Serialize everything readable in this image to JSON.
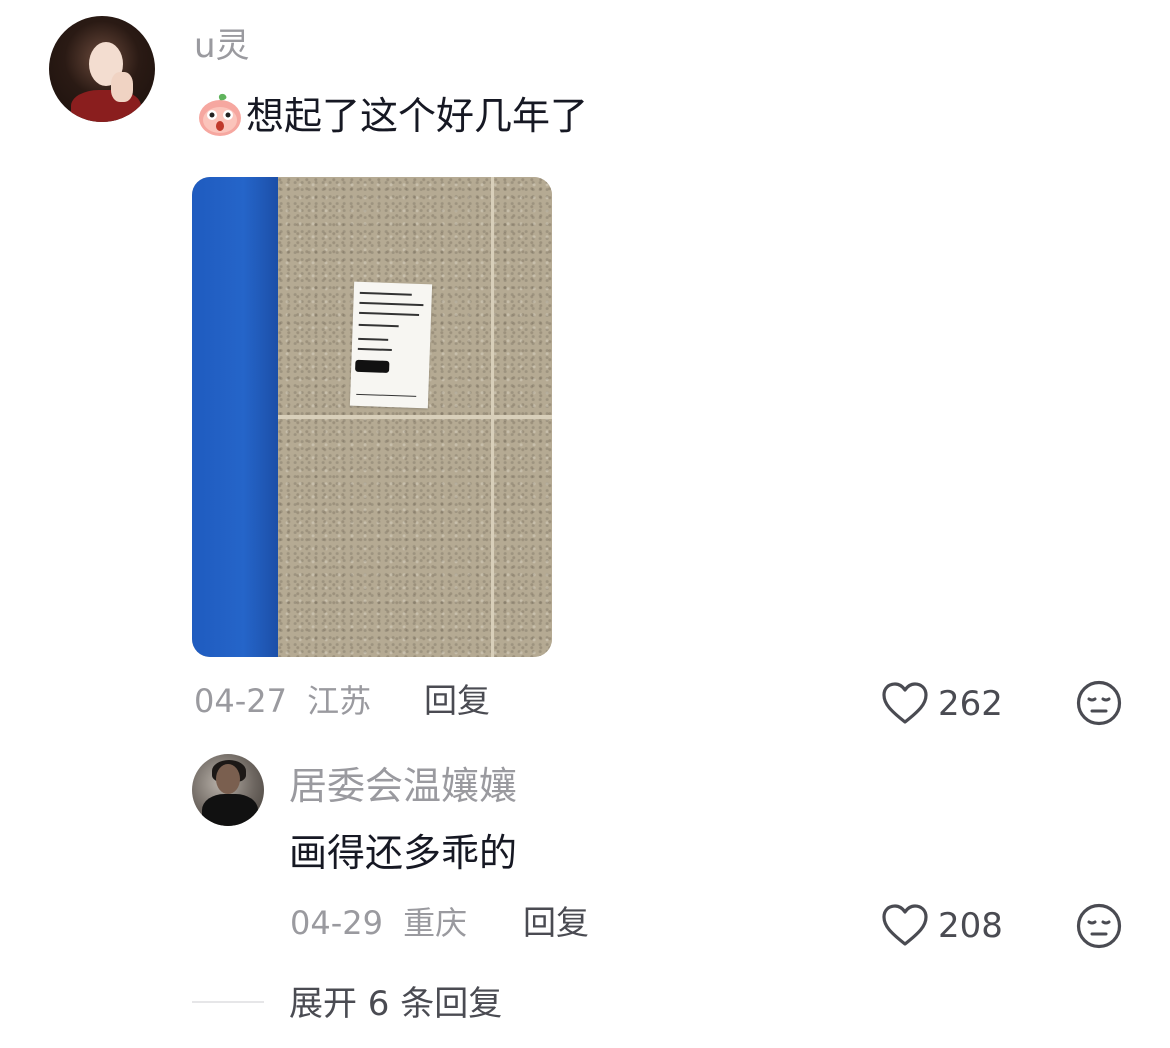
{
  "comment": {
    "username": "u灵",
    "emoji_icon": "surprised-peach-emoji",
    "text": "想起了这个好几年了",
    "date": "04-27",
    "location": "江苏",
    "reply_label": "回复",
    "like_count": "262"
  },
  "reply": {
    "username": "居委会温孃孃",
    "text": "画得还多乖的",
    "date": "04-29",
    "location": "重庆",
    "reply_label": "回复",
    "like_count": "208"
  },
  "expand_label": "展开 6 条回复",
  "icons": {
    "like": "heart-outline-icon",
    "dislike": "neutral-face-icon"
  },
  "colors": {
    "muted_text": "#9a9a9f",
    "primary_text": "#161823",
    "action_text": "#4a4b52"
  }
}
